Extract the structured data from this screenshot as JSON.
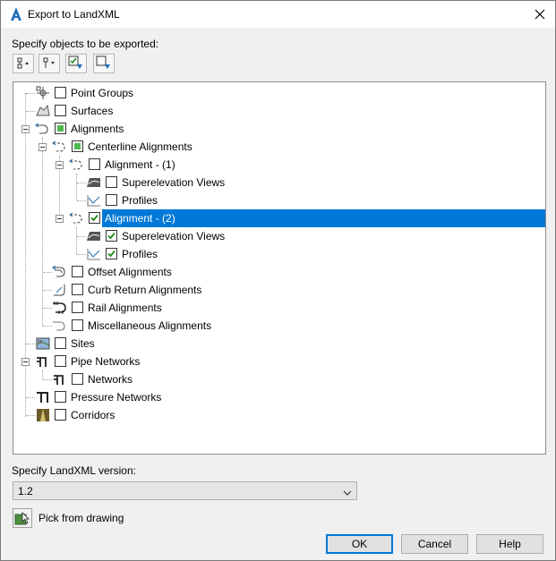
{
  "window": {
    "title": "Export to LandXML"
  },
  "labels": {
    "specify_objects": "Specify objects to be exported:",
    "specify_version": "Specify LandXML version:",
    "pick_from_drawing": "Pick from drawing"
  },
  "toolbar": {
    "buttons": [
      "expand-all-icon",
      "collapse-all-icon",
      "check-all-icon",
      "uncheck-all-icon"
    ]
  },
  "tree": {
    "items": [
      {
        "label": "Point Groups",
        "state": "unchecked",
        "icon": "point-groups-icon"
      },
      {
        "label": "Surfaces",
        "state": "unchecked",
        "icon": "surfaces-icon"
      },
      {
        "label": "Alignments",
        "state": "partial",
        "icon": "alignments-icon"
      },
      {
        "label": "Centerline Alignments",
        "state": "partial",
        "icon": "centerline-alignments-icon"
      },
      {
        "label": "Alignment - (1)",
        "state": "unchecked",
        "icon": "alignment-icon"
      },
      {
        "label": "Superelevation Views",
        "state": "unchecked",
        "icon": "superelevation-views-icon"
      },
      {
        "label": "Profiles",
        "state": "unchecked",
        "icon": "profiles-icon"
      },
      {
        "label": "Alignment - (2)",
        "state": "checked",
        "icon": "alignment-icon",
        "selected": true
      },
      {
        "label": "Superelevation Views",
        "state": "checked",
        "icon": "superelevation-views-icon"
      },
      {
        "label": "Profiles",
        "state": "checked",
        "icon": "profiles-icon"
      },
      {
        "label": "Offset Alignments",
        "state": "unchecked",
        "icon": "offset-alignments-icon"
      },
      {
        "label": "Curb Return Alignments",
        "state": "unchecked",
        "icon": "curb-return-alignments-icon"
      },
      {
        "label": "Rail Alignments",
        "state": "unchecked",
        "icon": "rail-alignments-icon"
      },
      {
        "label": "Miscellaneous Alignments",
        "state": "unchecked",
        "icon": "miscellaneous-alignments-icon"
      },
      {
        "label": "Sites",
        "state": "unchecked",
        "icon": "sites-icon"
      },
      {
        "label": "Pipe Networks",
        "state": "unchecked",
        "icon": "pipe-networks-icon"
      },
      {
        "label": "Networks",
        "state": "unchecked",
        "icon": "networks-icon"
      },
      {
        "label": "Pressure Networks",
        "state": "unchecked",
        "icon": "pressure-networks-icon"
      },
      {
        "label": "Corridors",
        "state": "unchecked",
        "icon": "corridors-icon"
      }
    ]
  },
  "version": {
    "selected": "1.2"
  },
  "buttons": {
    "ok": "OK",
    "cancel": "Cancel",
    "help": "Help"
  },
  "colors": {
    "selection": "#0078d7",
    "check_green": "#4fb84f",
    "accent": "#0078d7"
  }
}
